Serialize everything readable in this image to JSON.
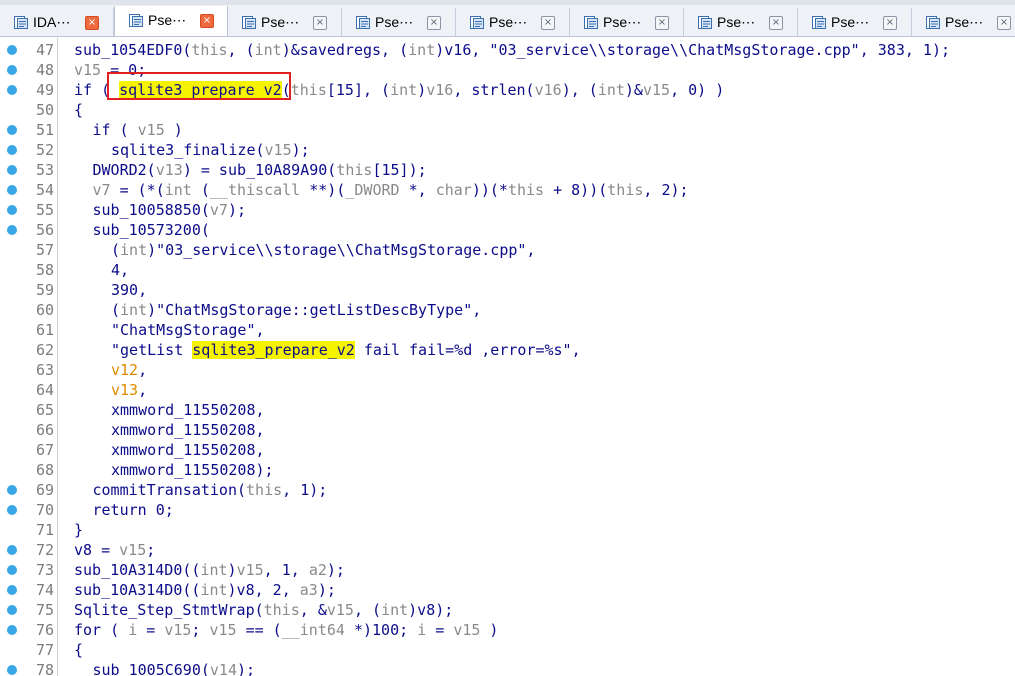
{
  "tabs": [
    {
      "label": "IDA⋯",
      "active": false,
      "close": "red"
    },
    {
      "label": "Pse⋯",
      "active": true,
      "close": "red"
    },
    {
      "label": "Pse⋯",
      "active": false,
      "close": "gray"
    },
    {
      "label": "Pse⋯",
      "active": false,
      "close": "gray"
    },
    {
      "label": "Pse⋯",
      "active": false,
      "close": "gray"
    },
    {
      "label": "Pse⋯",
      "active": false,
      "close": "gray"
    },
    {
      "label": "Pse⋯",
      "active": false,
      "close": "gray"
    },
    {
      "label": "Pse⋯",
      "active": false,
      "close": "gray"
    },
    {
      "label": "Pse⋯",
      "active": false,
      "close": "gray"
    }
  ],
  "close_glyph": "×",
  "highlight_token": "sqlite3_prepare_v2",
  "colors": {
    "breakpoint_dot": "#3aa6e6",
    "highlight": "#f6f300",
    "redbox": "#e02020",
    "code": "#0c0c8a"
  },
  "lines": [
    {
      "n": "47",
      "dot": true,
      "indent": 0,
      "segs": [
        [
          "k",
          "sub_1054EDF0("
        ],
        [
          "v",
          "this"
        ],
        [
          "k",
          ", ("
        ],
        [
          "v",
          "int"
        ],
        [
          "k",
          ")&savedregs, ("
        ],
        [
          "v",
          "int"
        ],
        [
          "k",
          ")v16, \"03_service\\\\storage\\\\ChatMsgStorage.cpp\", 383, 1);"
        ]
      ]
    },
    {
      "n": "48",
      "dot": true,
      "indent": 0,
      "segs": [
        [
          "v",
          "v15"
        ],
        [
          "k",
          " = 0;"
        ]
      ]
    },
    {
      "n": "49",
      "dot": true,
      "indent": 0,
      "segs": [
        [
          "k",
          "if ( "
        ],
        [
          "h",
          "sqlite3_prepare_v2"
        ],
        [
          "k",
          "("
        ],
        [
          "v",
          "this"
        ],
        [
          "k",
          "[15], ("
        ],
        [
          "v",
          "int"
        ],
        [
          "k",
          ")"
        ],
        [
          "v",
          "v16"
        ],
        [
          "k",
          ", strlen("
        ],
        [
          "v",
          "v16"
        ],
        [
          "k",
          "), ("
        ],
        [
          "v",
          "int"
        ],
        [
          "k",
          ")&"
        ],
        [
          "v",
          "v15"
        ],
        [
          "k",
          ", 0) )"
        ]
      ]
    },
    {
      "n": "50",
      "dot": false,
      "indent": 0,
      "segs": [
        [
          "k",
          "{"
        ]
      ]
    },
    {
      "n": "51",
      "dot": true,
      "indent": 1,
      "segs": [
        [
          "k",
          "if ( "
        ],
        [
          "v",
          "v15"
        ],
        [
          "k",
          " )"
        ]
      ]
    },
    {
      "n": "52",
      "dot": true,
      "indent": 2,
      "segs": [
        [
          "k",
          "sqlite3_finalize("
        ],
        [
          "v",
          "v15"
        ],
        [
          "k",
          ");"
        ]
      ]
    },
    {
      "n": "53",
      "dot": true,
      "indent": 1,
      "segs": [
        [
          "k",
          "DWORD2("
        ],
        [
          "v",
          "v13"
        ],
        [
          "k",
          ") = sub_10A89A90("
        ],
        [
          "v",
          "this"
        ],
        [
          "k",
          "[15]);"
        ]
      ]
    },
    {
      "n": "54",
      "dot": true,
      "indent": 1,
      "segs": [
        [
          "v",
          "v7"
        ],
        [
          "k",
          " = (*("
        ],
        [
          "v",
          "int"
        ],
        [
          "k",
          " ("
        ],
        [
          "v",
          "__thiscall"
        ],
        [
          "k",
          " **)("
        ],
        [
          "v",
          "_DWORD"
        ],
        [
          "k",
          " *, "
        ],
        [
          "v",
          "char"
        ],
        [
          "k",
          "))(*"
        ],
        [
          "v",
          "this"
        ],
        [
          "k",
          " + 8))("
        ],
        [
          "v",
          "this"
        ],
        [
          "k",
          ", 2);"
        ]
      ]
    },
    {
      "n": "55",
      "dot": true,
      "indent": 1,
      "segs": [
        [
          "k",
          "sub_10058850("
        ],
        [
          "v",
          "v7"
        ],
        [
          "k",
          ");"
        ]
      ]
    },
    {
      "n": "56",
      "dot": true,
      "indent": 1,
      "segs": [
        [
          "k",
          "sub_10573200("
        ]
      ]
    },
    {
      "n": "57",
      "dot": false,
      "indent": 2,
      "segs": [
        [
          "k",
          "("
        ],
        [
          "v",
          "int"
        ],
        [
          "k",
          ")\"03_service\\\\storage\\\\ChatMsgStorage.cpp\","
        ]
      ]
    },
    {
      "n": "58",
      "dot": false,
      "indent": 2,
      "segs": [
        [
          "k",
          "4,"
        ]
      ]
    },
    {
      "n": "59",
      "dot": false,
      "indent": 2,
      "segs": [
        [
          "k",
          "390,"
        ]
      ]
    },
    {
      "n": "60",
      "dot": false,
      "indent": 2,
      "segs": [
        [
          "k",
          "("
        ],
        [
          "v",
          "int"
        ],
        [
          "k",
          ")\"ChatMsgStorage::getListDescByType\","
        ]
      ]
    },
    {
      "n": "61",
      "dot": false,
      "indent": 2,
      "segs": [
        [
          "k",
          "\"ChatMsgStorage\","
        ]
      ]
    },
    {
      "n": "62",
      "dot": false,
      "indent": 2,
      "segs": [
        [
          "k",
          "\"getList "
        ],
        [
          "h",
          "sqlite3_prepare_v2"
        ],
        [
          "k",
          " fail fail=%d ,error=%s\","
        ]
      ]
    },
    {
      "n": "63",
      "dot": false,
      "indent": 2,
      "segs": [
        [
          "o",
          "v12"
        ],
        [
          "k",
          ","
        ]
      ]
    },
    {
      "n": "64",
      "dot": false,
      "indent": 2,
      "segs": [
        [
          "o",
          "v13"
        ],
        [
          "k",
          ","
        ]
      ]
    },
    {
      "n": "65",
      "dot": false,
      "indent": 2,
      "segs": [
        [
          "k",
          "xmmword_11550208,"
        ]
      ]
    },
    {
      "n": "66",
      "dot": false,
      "indent": 2,
      "segs": [
        [
          "k",
          "xmmword_11550208,"
        ]
      ]
    },
    {
      "n": "67",
      "dot": false,
      "indent": 2,
      "segs": [
        [
          "k",
          "xmmword_11550208,"
        ]
      ]
    },
    {
      "n": "68",
      "dot": false,
      "indent": 2,
      "segs": [
        [
          "k",
          "xmmword_11550208);"
        ]
      ]
    },
    {
      "n": "69",
      "dot": true,
      "indent": 1,
      "segs": [
        [
          "k",
          "commitTransation("
        ],
        [
          "v",
          "this"
        ],
        [
          "k",
          ", 1);"
        ]
      ]
    },
    {
      "n": "70",
      "dot": true,
      "indent": 1,
      "segs": [
        [
          "k",
          "return 0;"
        ]
      ]
    },
    {
      "n": "71",
      "dot": false,
      "indent": 0,
      "segs": [
        [
          "k",
          "}"
        ]
      ]
    },
    {
      "n": "72",
      "dot": true,
      "indent": 0,
      "segs": [
        [
          "k",
          "v8 = "
        ],
        [
          "v",
          "v15"
        ],
        [
          "k",
          ";"
        ]
      ]
    },
    {
      "n": "73",
      "dot": true,
      "indent": 0,
      "segs": [
        [
          "k",
          "sub_10A314D0(("
        ],
        [
          "v",
          "int"
        ],
        [
          "k",
          ")"
        ],
        [
          "v",
          "v15"
        ],
        [
          "k",
          ", 1, "
        ],
        [
          "v",
          "a2"
        ],
        [
          "k",
          ");"
        ]
      ]
    },
    {
      "n": "74",
      "dot": true,
      "indent": 0,
      "segs": [
        [
          "k",
          "sub_10A314D0(("
        ],
        [
          "v",
          "int"
        ],
        [
          "k",
          ")v8, 2, "
        ],
        [
          "v",
          "a3"
        ],
        [
          "k",
          ");"
        ]
      ]
    },
    {
      "n": "75",
      "dot": true,
      "indent": 0,
      "segs": [
        [
          "k",
          "Sqlite_Step_StmtWrap("
        ],
        [
          "v",
          "this"
        ],
        [
          "k",
          ", &"
        ],
        [
          "v",
          "v15"
        ],
        [
          "k",
          ", ("
        ],
        [
          "v",
          "int"
        ],
        [
          "k",
          ")v8);"
        ]
      ]
    },
    {
      "n": "76",
      "dot": true,
      "indent": 0,
      "segs": [
        [
          "k",
          "for ( "
        ],
        [
          "v",
          "i"
        ],
        [
          "k",
          " = "
        ],
        [
          "v",
          "v15"
        ],
        [
          "k",
          "; "
        ],
        [
          "v",
          "v15"
        ],
        [
          "k",
          " == ("
        ],
        [
          "v",
          "__int64"
        ],
        [
          "k",
          " *)100; "
        ],
        [
          "v",
          "i"
        ],
        [
          "k",
          " = "
        ],
        [
          "v",
          "v15"
        ],
        [
          "k",
          " )"
        ]
      ]
    },
    {
      "n": "77",
      "dot": false,
      "indent": 0,
      "segs": [
        [
          "k",
          "{"
        ]
      ]
    },
    {
      "n": "78",
      "dot": true,
      "indent": 1,
      "segs": [
        [
          "k",
          "sub_1005C690("
        ],
        [
          "v",
          "v14"
        ],
        [
          "k",
          ");"
        ]
      ]
    }
  ]
}
